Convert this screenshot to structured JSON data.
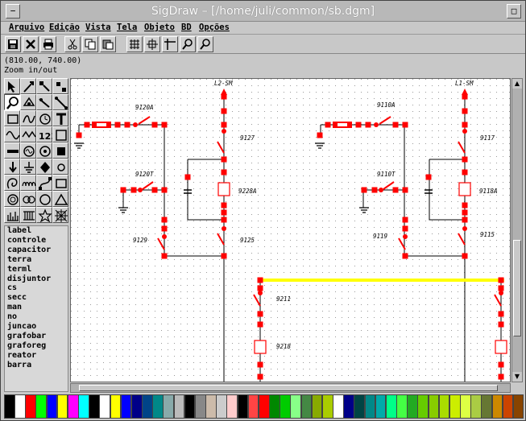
{
  "window": {
    "title": "SigDraw – [/home/juli/common/sb.dgm]"
  },
  "menu": [
    "Arquivo",
    "Edição",
    "Vista",
    "Tela",
    "Objeto",
    "BD",
    "Opções"
  ],
  "toolbar_icons": [
    "save-icon",
    "close-icon",
    "print-icon",
    "cut-icon",
    "copy-icon",
    "paste-icon",
    "grid-icon",
    "snap-icon",
    "align-icon",
    "zoom-pan-icon",
    "zoom-icon"
  ],
  "status": {
    "coords": "(810.00, 740.00)",
    "message": "Zoom in/out"
  },
  "components": [
    "label",
    "controle",
    "capacitor",
    "terra",
    "terml",
    "disjuntor",
    "cs",
    "secc",
    "man",
    "no",
    "juncao",
    "grafobar",
    "graforeg",
    "reator",
    "barra"
  ],
  "diagram": {
    "labels": {
      "l2sm": "L2-SM",
      "l1sm": "L1-SM",
      "s9120a": "9120A",
      "s9110a": "9110A",
      "s9127": "9127",
      "s9117": "9117",
      "s9120t": "9120T",
      "s9110t": "9110T",
      "s9228": "9228A",
      "s9118": "9118A",
      "s9129": "9129",
      "s9125": "9125",
      "s9119": "9119",
      "s9115": "9115",
      "s9211": "9211",
      "s9218": "9218"
    },
    "colors": {
      "element": "#ff0000",
      "wire": "#000000",
      "bus": "#ffff00",
      "dot": "#888888"
    }
  },
  "colors": [
    "#000000",
    "#ffffff",
    "#ff0000",
    "#00ff00",
    "#0000ff",
    "#ffff00",
    "#ff00ff",
    "#00ffff",
    "#000000",
    "#ffffff",
    "#ffff00",
    "#0000ff",
    "#000088",
    "#004488",
    "#008888",
    "#88aaaa",
    "#bbbbbb",
    "#000000",
    "#888888",
    "#ccbbaa",
    "#cccccc",
    "#ffcccc",
    "#000000",
    "#ff4444",
    "#ff0000",
    "#008800",
    "#00cc00",
    "#88ff88",
    "#448844",
    "#88aa00",
    "#aacc00",
    "#ffffff",
    "#000088",
    "#004444",
    "#008888",
    "#00aaaa",
    "#00ff88",
    "#44ff44",
    "#22aa22",
    "#66cc00",
    "#88cc00",
    "#aadd00",
    "#ccee00",
    "#ddff44",
    "#aacc44",
    "#667733",
    "#cc8800",
    "#cc4400",
    "#884400"
  ]
}
